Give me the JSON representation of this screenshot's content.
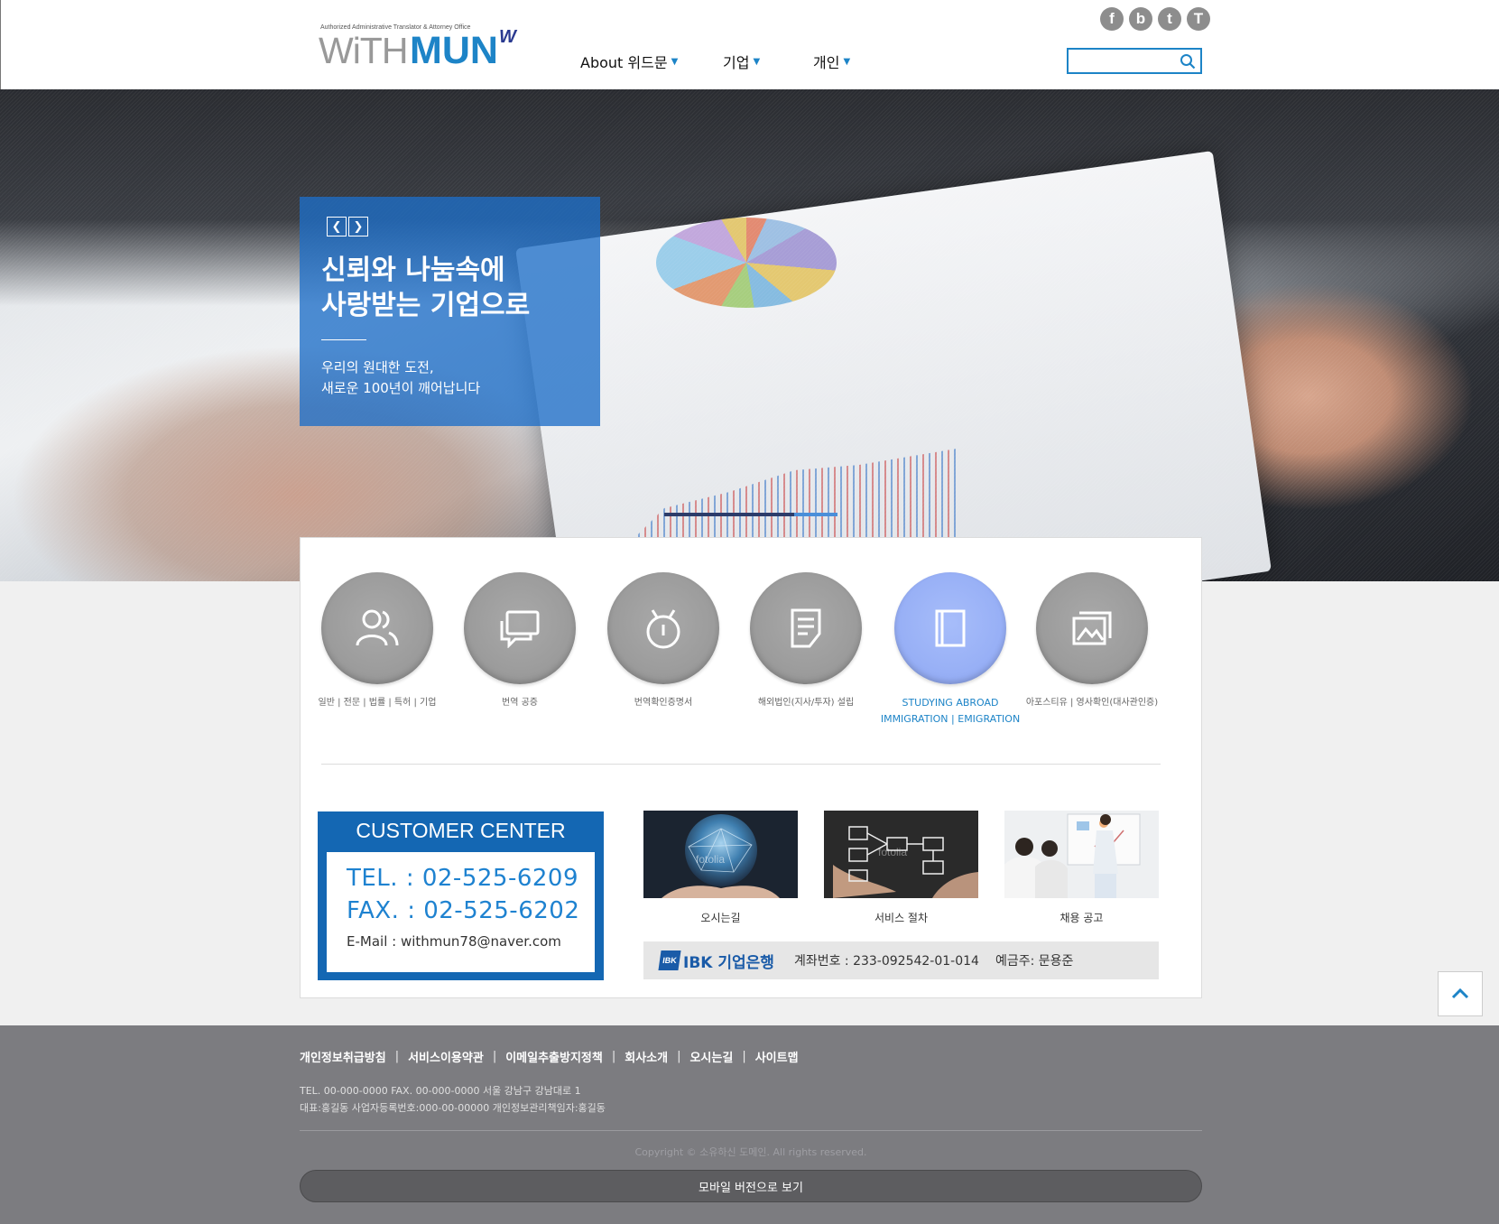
{
  "header": {
    "logo_tagline": "Authorized Administrative Translator & Attorney Office",
    "logo_with": "WiTH",
    "logo_mun": "MUN",
    "nav": [
      "About 위드문",
      "기업",
      "개인"
    ],
    "social_icons": [
      "facebook-icon",
      "blog-icon",
      "twitter-icon",
      "tistory-icon"
    ],
    "search_placeholder": ""
  },
  "hero": {
    "headline_line1": "신뢰와 나눔속에",
    "headline_line2": "사랑받는 기업으로",
    "sub_line1": "우리의 원대한 도전,",
    "sub_line2": "새로운 100년이 깨어납니다",
    "slide_progress": 0.75
  },
  "services": [
    {
      "icon": "people-icon",
      "label": "일반 | 전문 | 법률 | 특허 | 기업"
    },
    {
      "icon": "chat-icon",
      "label": "번역 공증"
    },
    {
      "icon": "stopwatch-icon",
      "label": "번역확인증명서"
    },
    {
      "icon": "document-icon",
      "label": "해외법인(지사/투자) 설립"
    },
    {
      "icon": "book-icon",
      "label": "STUDYING ABROAD",
      "label2": "IMMIGRATION | EMIGRATION",
      "active": true
    },
    {
      "icon": "gallery-icon",
      "label": "아포스티유 | 영사확인(대사관인증)"
    }
  ],
  "customer_center": {
    "title": "CUSTOMER CENTER",
    "tel": "TEL. :  02-525-6209",
    "fax": "FAX. :  02-525-6202",
    "email": "E-Mail  :   withmun78@naver.com"
  },
  "thumbnails": [
    {
      "label": "오시는길",
      "watermark": "fotolia"
    },
    {
      "label": "서비스 절차",
      "watermark": "fotolia"
    },
    {
      "label": "채용 공고"
    }
  ],
  "bank": {
    "logo_mark": "IBK",
    "name": "IBK 기업은행",
    "account": "계좌번호 : 233-092542-01-014",
    "holder": "예금주: 문용준"
  },
  "footer": {
    "links": [
      "개인정보취급방침",
      "서비스이용약관",
      "이메일추출방지정책",
      "회사소개",
      "오시는길",
      "사이트맵"
    ],
    "info_line1": "TEL. 00-000-0000 FAX. 00-000-0000 서울 강남구 강남대로 1",
    "info_line2": "대표:홍길동 사업자등록번호:000-00-00000 개인정보관리책임자:홍길동",
    "copyright": "Copyright © 소유하신 도메인. All rights reserved.",
    "mobile_button": "모바일 버전으로 보기"
  },
  "colors": {
    "brand_blue": "#1d84c7",
    "promo_blue": "#1e6ec8",
    "active_circle": "#98b0f6",
    "footer_bg": "#7c7c80"
  }
}
